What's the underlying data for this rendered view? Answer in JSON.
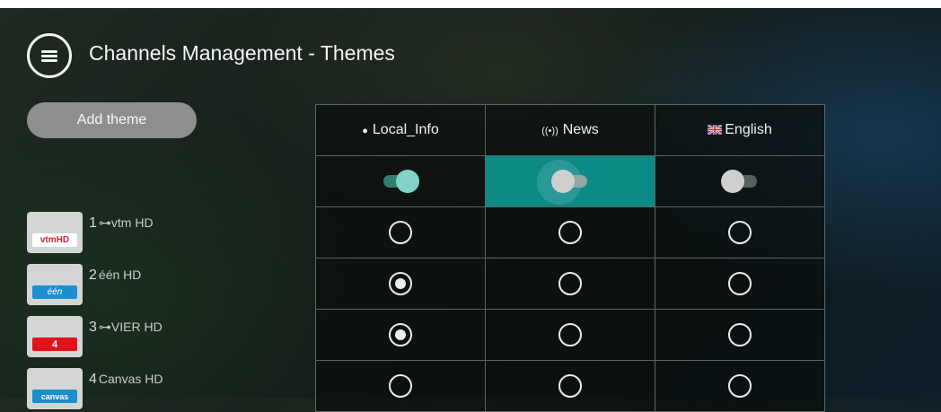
{
  "header": {
    "title": "Channels Management - Themes",
    "menu_icon": "hamburger-menu-icon"
  },
  "sidebar": {
    "add_theme_label": "Add theme",
    "channels": [
      {
        "number": "1",
        "name": "vtm HD",
        "locked": true,
        "logo": "vtm-hd-logo"
      },
      {
        "number": "2",
        "name": "één HD",
        "locked": false,
        "logo": "een-hd-logo"
      },
      {
        "number": "3",
        "name": "VIER HD",
        "locked": true,
        "logo": "vier-hd-logo"
      },
      {
        "number": "4",
        "name": "Canvas HD",
        "locked": false,
        "logo": "canvas-hd-logo"
      }
    ]
  },
  "themes": {
    "columns": [
      {
        "label": "Local_Info",
        "icon": "info-icon",
        "enabled": true
      },
      {
        "label": "News",
        "icon": "broadcast-icon",
        "enabled": false,
        "focused": true
      },
      {
        "label": "English",
        "icon": "uk-flag-icon",
        "enabled": false
      }
    ],
    "rows": [
      [
        false,
        false,
        false
      ],
      [
        true,
        false,
        false
      ],
      [
        true,
        false,
        false
      ],
      [
        false,
        false,
        false
      ]
    ]
  },
  "colors": {
    "accent": "#0b8a86",
    "toggle_on_track": "#2f7f72",
    "toggle_on_knob": "#7fd3c7",
    "toggle_off_knob": "#cfcfcf",
    "toggle_off_track": "#5a5f5e",
    "add_theme_bg": "#8c8f8c"
  },
  "logos": {
    "vtm": "vtmHD",
    "een": "één",
    "vier": "4",
    "canvas": "canvas"
  }
}
